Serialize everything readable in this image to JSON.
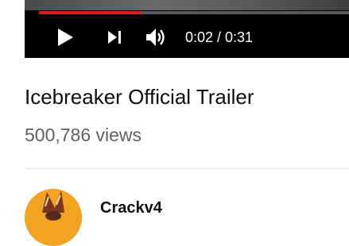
{
  "player": {
    "progress_fraction": 0.33,
    "time_display": "0:02 / 0:31",
    "colors": {
      "background": "#000000",
      "progress": "#e21a1a"
    },
    "controls": {
      "play_icon": "play-icon",
      "next_icon": "next-icon",
      "volume_icon": "volume-icon"
    }
  },
  "video": {
    "title": "Icebreaker Official Trailer",
    "views": "500,786 views"
  },
  "channel": {
    "name": "Crackv4",
    "avatar_color": "#f2a321"
  }
}
